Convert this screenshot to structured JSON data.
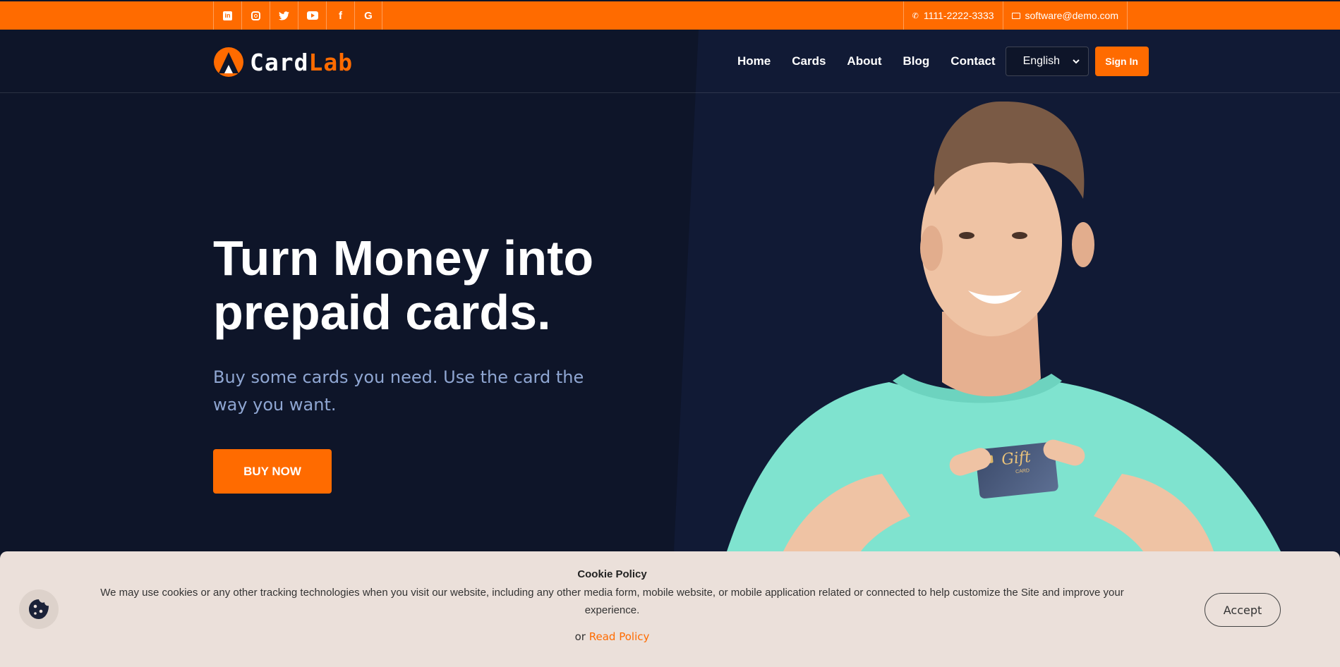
{
  "topbar": {
    "social": [
      {
        "icon": "linkedin-icon",
        "glyph": "in"
      },
      {
        "icon": "instagram-icon",
        "glyph": "◎"
      },
      {
        "icon": "twitter-icon",
        "glyph": "🐦"
      },
      {
        "icon": "youtube-icon",
        "glyph": "▶"
      },
      {
        "icon": "facebook-icon",
        "glyph": "f"
      },
      {
        "icon": "google-icon",
        "glyph": "G"
      }
    ],
    "phone": "1111-2222-3333",
    "email": "software@demo.com"
  },
  "header": {
    "logo_part1": "Card",
    "logo_part2": "Lab",
    "nav": [
      "Home",
      "Cards",
      "About",
      "Blog",
      "Contact"
    ],
    "language": "English",
    "signin_label": "Sign In"
  },
  "hero": {
    "title_line1": "Turn Money into",
    "title_line2": "prepaid cards.",
    "subtitle": "Buy some cards you need. Use the card the way you want.",
    "button_label": "BUY NOW",
    "card_text": "Gift",
    "card_sub": "CARD"
  },
  "cookie": {
    "title": "Cookie Policy",
    "text": "We may use cookies or any other tracking technologies when you visit our website, including any other media form, mobile website, or mobile application related or connected to help customize the Site and improve your experience.",
    "or": "or",
    "policy_link": "Read Policy",
    "accept_label": "Accept"
  },
  "colors": {
    "accent": "#ff6b00",
    "background": "#0e1529",
    "subtitle": "#8fa6d2",
    "shirt": "#7fe3cf",
    "cookie_bg": "#ebe0da"
  }
}
